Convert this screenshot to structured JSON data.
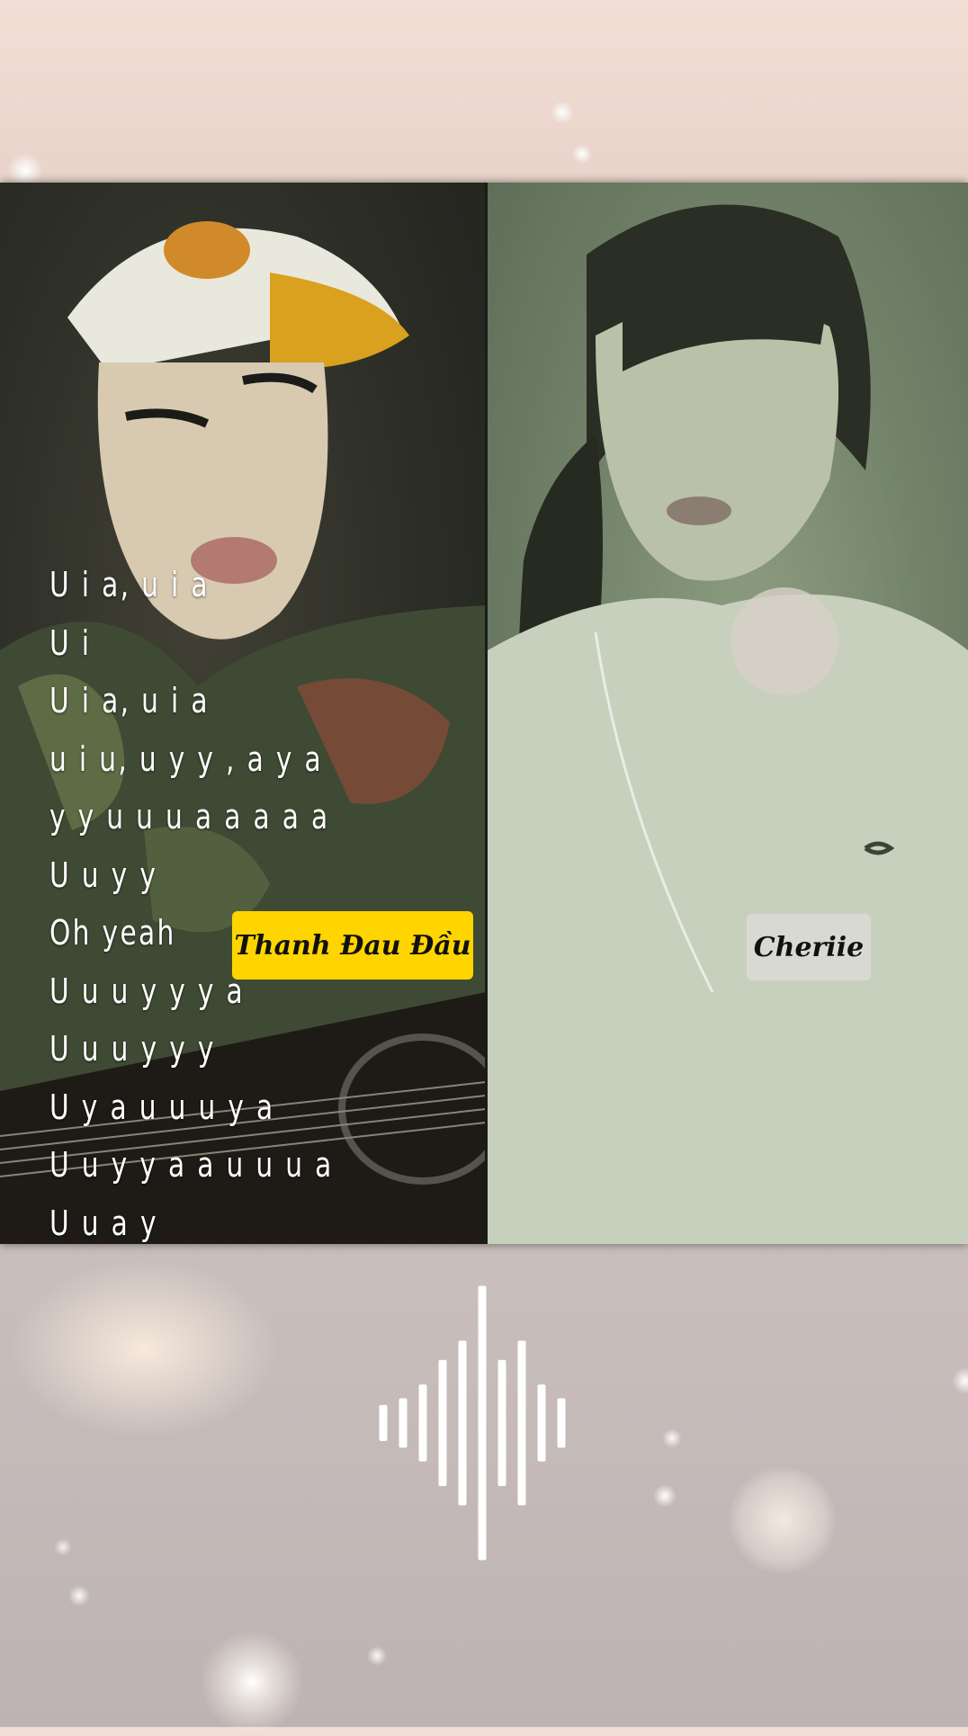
{
  "lyrics": [
    "U i a, u i a",
    "U i",
    "U i a, u i a",
    "u i u, u y y , a y a",
    "y y u u u a a a a a",
    "U u y y",
    "Oh yeah",
    "U u u y y y a",
    "U u u y y y",
    "U y a u u u y a",
    "U u y y a a u u u a",
    "U u a y"
  ],
  "participants": {
    "left_name": "Thanh Đau Đầu",
    "right_name": "Cheriie"
  },
  "audio_visualizer": {
    "icon": "sound-wave-icon",
    "levels": [
      0.12,
      0.18,
      0.28,
      0.46,
      0.6,
      1.0,
      0.46,
      0.6,
      0.28,
      0.18
    ]
  },
  "colors": {
    "left_tag": "#ffd500",
    "right_tag": "#d9d9d3",
    "lyrics_text": "#ffffff"
  }
}
